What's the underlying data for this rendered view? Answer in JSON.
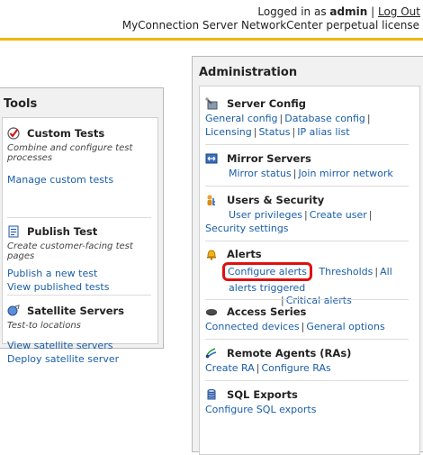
{
  "header": {
    "logged_in_prefix": "Logged in as",
    "username": "admin",
    "logout": "Log Out",
    "license": "MyConnection Server NetworkCenter perpetual license"
  },
  "tools": {
    "title": "Tools",
    "custom_tests": {
      "title": "Custom Tests",
      "desc": "Combine and configure test processes",
      "links": [
        "Manage custom tests"
      ]
    },
    "publish_test": {
      "title": "Publish Test",
      "desc": "Create customer-facing test pages",
      "links": [
        "Publish a new test",
        "View published tests"
      ]
    },
    "satellite_servers": {
      "title": "Satellite Servers",
      "desc": "Test-to locations",
      "links": [
        "View satellite servers",
        "Deploy satellite server"
      ]
    }
  },
  "admin": {
    "title": "Administration",
    "server_config": {
      "title": "Server Config",
      "links": [
        "General config",
        "Database config",
        "Licensing",
        "Status",
        "IP alias list"
      ]
    },
    "mirror_servers": {
      "title": "Mirror Servers",
      "links": [
        "Mirror status",
        "Join mirror network"
      ]
    },
    "users_security": {
      "title": "Users & Security",
      "links": [
        "User privileges",
        "Create user",
        "Security settings"
      ]
    },
    "alerts": {
      "title": "Alerts",
      "links": [
        "Configure alerts",
        "Thresholds",
        "All alerts triggered",
        "Critical alerts"
      ]
    },
    "access_series": {
      "title": "Access Series",
      "links": [
        "Connected devices",
        "General options"
      ]
    },
    "remote_agents": {
      "title": "Remote Agents (RAs)",
      "links": [
        "Create RA",
        "Configure RAs"
      ]
    },
    "sql_exports": {
      "title": "SQL Exports",
      "links": [
        "Configure SQL exports"
      ]
    }
  },
  "colors": {
    "accent_bar": "#f0b800",
    "link": "#1a5ea8",
    "highlight": "#e01010"
  }
}
